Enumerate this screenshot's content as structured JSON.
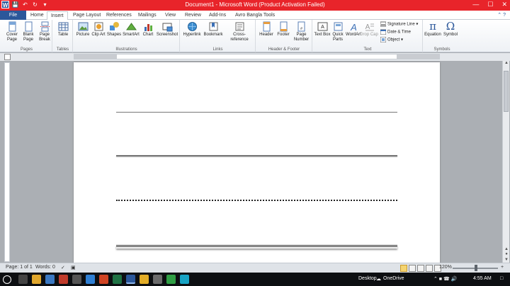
{
  "titlebar": {
    "title": "Document1 - Microsoft Word (Product Activation Failed)",
    "word_logo": "W",
    "quick_access": [
      "save-icon",
      "undo-icon",
      "redo-icon",
      "customize-icon"
    ],
    "controls": {
      "minimize": "—",
      "maximize": "☐",
      "close": "✕"
    }
  },
  "tabs": {
    "file": "File",
    "items": [
      "Home",
      "Insert",
      "Page Layout",
      "References",
      "Mailings",
      "View",
      "Review",
      "Add-Ins",
      "Avro Bangla Tools"
    ],
    "active": "Insert"
  },
  "ribbon": {
    "groups": {
      "pages": "Pages",
      "tables": "Tables",
      "illustrations": "Illustrations",
      "links": "Links",
      "header_footer": "Header & Footer",
      "text": "Text",
      "symbols": "Symbols"
    },
    "buttons": {
      "cover_page": "Cover Page",
      "blank_page": "Blank Page",
      "page_break": "Page Break",
      "table": "Table",
      "picture": "Picture",
      "clip_art": "Clip Art",
      "shapes": "Shapes",
      "smartart": "SmartArt",
      "chart": "Chart",
      "screenshot": "Screenshot",
      "hyperlink": "Hyperlink",
      "bookmark": "Bookmark",
      "cross_reference": "Cross-reference",
      "header": "Header",
      "footer": "Footer",
      "page_number": "Page Number",
      "text_box": "Text Box",
      "quick_parts": "Quick Parts",
      "wordart": "WordArt",
      "drop_cap": "Drop Cap",
      "signature_line": "Signature Line",
      "date_time": "Date & Time",
      "object": "Object",
      "equation": "Equation",
      "symbol": "Symbol"
    }
  },
  "status": {
    "page": "Page: 1 of 1",
    "words": "Words: 0",
    "zoom": "120%",
    "zoom_level_percent": 120
  },
  "taskbar": {
    "desktop": "Desktop",
    "onedrive": "OneDrive",
    "time": "4:55 AM"
  },
  "colors": {
    "titlebar": "#e8242a",
    "file_tab": "#2b579a",
    "taskbar": "#0d0f12"
  }
}
